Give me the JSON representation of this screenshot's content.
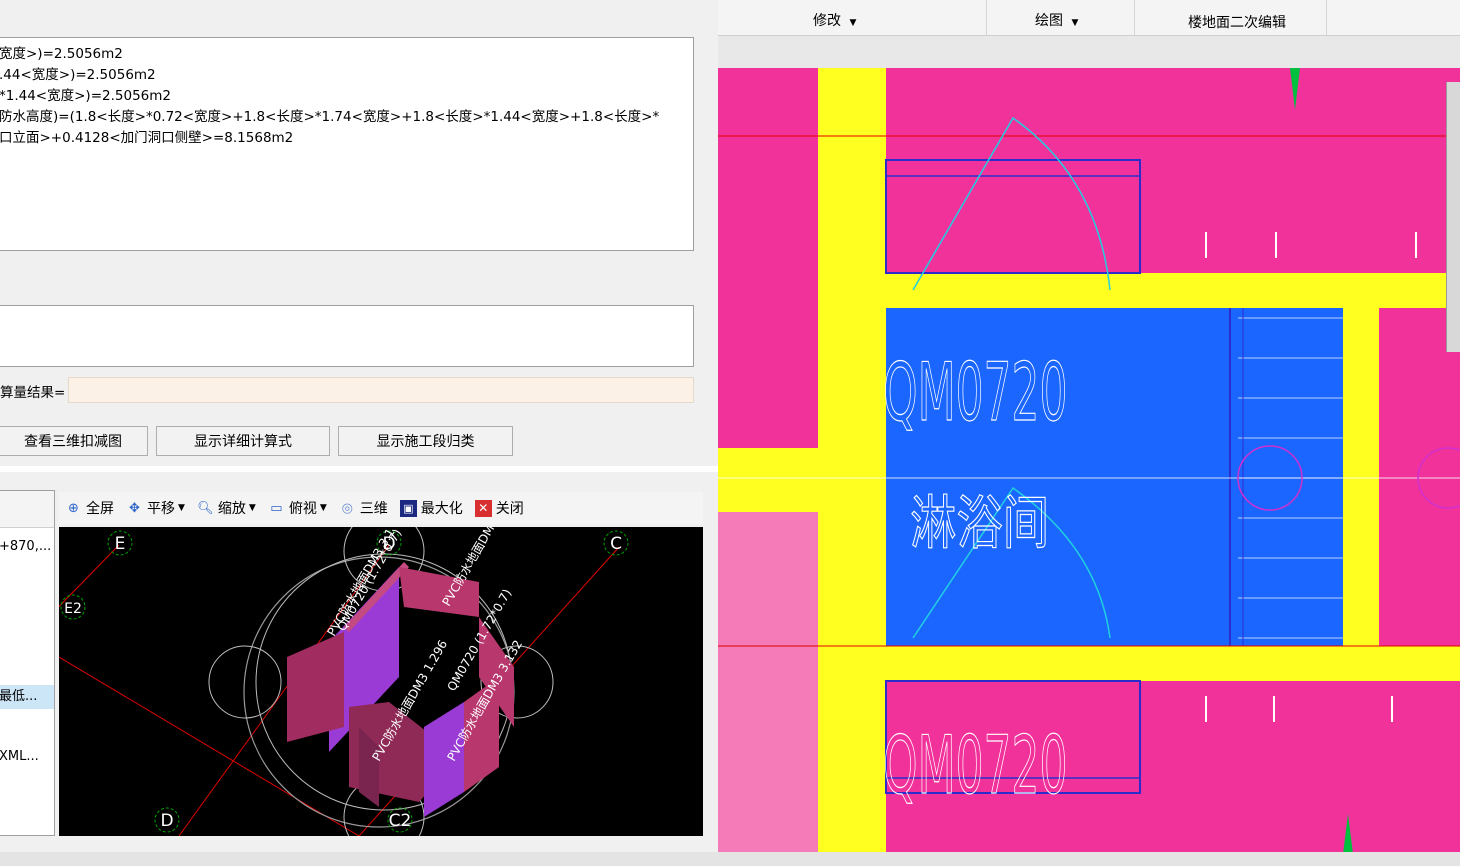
{
  "formula": {
    "lines": [
      "宽度>)=2.5056m2",
      ".44<宽度>)=2.5056m2",
      "*1.44<宽度>)=2.5056m2",
      "防水高度)=(1.8<长度>*0.72<宽度>+1.8<长度>*1.74<宽度>+1.8<长度>*1.44<宽度>+1.8<长度>*",
      "口立面>+0.4128<加门洞口侧壁>=8.1568m2"
    ]
  },
  "manual": {
    "result_label": "算量结果=",
    "result_value": ""
  },
  "buttons": {
    "view_3d_deduction": "查看三维扣减图",
    "show_detail_formula": "显示详细计算式",
    "show_section_group": "显示施工段归类"
  },
  "side_list": {
    "items": [
      {
        "label": "+870,...",
        "selected": false
      },
      {
        "label": "最低...",
        "selected": true
      },
      {
        "label": "XML...",
        "selected": false
      }
    ]
  },
  "viewer_toolbar": {
    "fullscreen": "全屏",
    "pan": "平移",
    "zoom": "缩放",
    "top_view": "俯视",
    "three_d": "三维",
    "maximize": "最大化",
    "close": "关闭"
  },
  "viewer_3d": {
    "axis_labels": [
      "E",
      "D",
      "C",
      "E2",
      "D",
      "C2"
    ],
    "texts": [
      "QM0720 (1.72*0.7)",
      "PVC防水地面DM3 3.132",
      "PVC防水地面DM3 1.296",
      "PVC防水地面DM",
      "PVC防水地面DM3 3.1",
      "QM0720 (1.72*0.7)"
    ],
    "colors": {
      "background": "#000000",
      "wall_magenta": "#b8386e",
      "wall_purple": "#9b3bd6",
      "axis": "#e00000",
      "axis_bubble": "#00a000"
    }
  },
  "cad_menubar": {
    "modify": "修改",
    "draw": "绘图",
    "floor_edit": "楼地面二次编辑"
  },
  "cad_drawing": {
    "door_labels": [
      "QM0720",
      "QM0720"
    ],
    "room_label": "淋浴间",
    "colors": {
      "background": "#f2329b",
      "wall": "#ffff20",
      "room": "#1a66ff",
      "door_arc": "#20d0e0"
    }
  }
}
